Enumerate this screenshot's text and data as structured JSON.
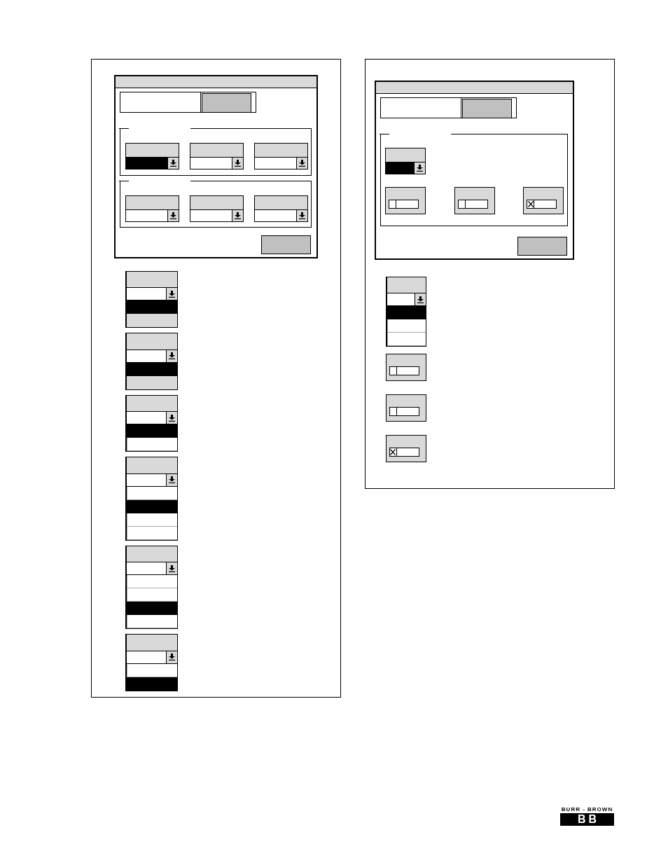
{
  "figures": [
    {
      "dialog": {
        "tabs": [
          {
            "selected": true
          },
          {
            "selected": false
          }
        ],
        "groups": [
          {
            "controls": [
              {
                "kind": "dropdown",
                "highlighted": true
              },
              {
                "kind": "dropdown",
                "highlighted": false
              },
              {
                "kind": "dropdown",
                "highlighted": false
              }
            ]
          },
          {
            "controls": [
              {
                "kind": "dropdown",
                "highlighted": false
              },
              {
                "kind": "dropdown",
                "highlighted": false
              },
              {
                "kind": "dropdown",
                "highlighted": false
              }
            ]
          }
        ]
      },
      "examples": [
        {
          "kind": "dropdown",
          "items": [
            {
              "selected": true,
              "disabled": false
            },
            {
              "selected": false,
              "disabled": true
            }
          ]
        },
        {
          "kind": "dropdown",
          "items": [
            {
              "selected": true,
              "disabled": false
            },
            {
              "selected": false,
              "disabled": true
            }
          ]
        },
        {
          "kind": "dropdown",
          "items": [
            {
              "selected": true,
              "disabled": false
            },
            {
              "selected": false,
              "disabled": false
            }
          ]
        },
        {
          "kind": "dropdown",
          "items": [
            {
              "selected": false,
              "disabled": false
            },
            {
              "selected": true,
              "disabled": false
            },
            {
              "selected": false,
              "disabled": false
            },
            {
              "selected": false,
              "disabled": false
            }
          ]
        },
        {
          "kind": "dropdown",
          "items": [
            {
              "selected": false,
              "disabled": false
            },
            {
              "selected": false,
              "disabled": false
            },
            {
              "selected": true,
              "disabled": false
            },
            {
              "selected": false,
              "disabled": false
            }
          ]
        },
        {
          "kind": "dropdown",
          "items": [
            {
              "selected": false,
              "disabled": false
            },
            {
              "selected": true,
              "disabled": false
            }
          ]
        }
      ]
    },
    {
      "dialog": {
        "tabs": [
          {
            "selected": true
          },
          {
            "selected": false
          }
        ],
        "groups": [
          {
            "controls": [
              {
                "kind": "dropdown",
                "highlighted": true
              },
              {
                "kind": "checkbox",
                "checked": false
              },
              {
                "kind": "checkbox",
                "checked": false
              },
              {
                "kind": "checkbox",
                "checked": true
              }
            ]
          }
        ]
      },
      "examples": [
        {
          "kind": "dropdown",
          "items": [
            {
              "selected": true,
              "disabled": false
            },
            {
              "selected": false,
              "disabled": false
            },
            {
              "selected": false,
              "disabled": false
            }
          ]
        },
        {
          "kind": "checkbox",
          "checked": false
        },
        {
          "kind": "checkbox",
          "checked": false
        },
        {
          "kind": "checkbox",
          "checked": true
        }
      ]
    }
  ],
  "logo": {
    "name": "BURR - BROWN",
    "mark": "BB"
  }
}
